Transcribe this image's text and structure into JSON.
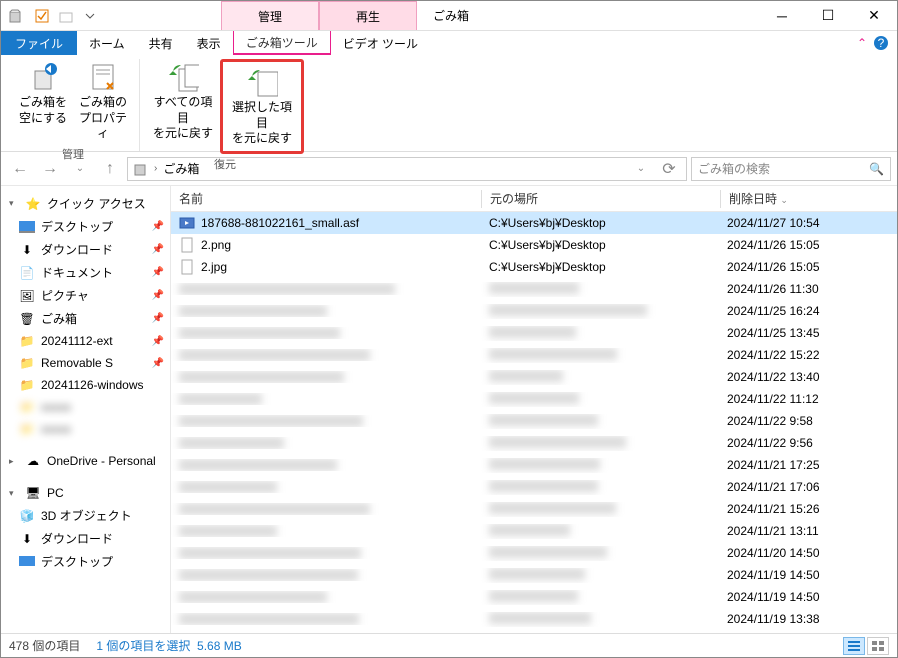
{
  "window": {
    "title": "ごみ箱"
  },
  "context_tabs": {
    "manage": "管理",
    "play": "再生"
  },
  "tabs": {
    "file": "ファイル",
    "home": "ホーム",
    "share": "共有",
    "view": "表示",
    "recycle_tools": "ごみ箱ツール",
    "video_tools": "ビデオ ツール"
  },
  "ribbon": {
    "empty": "ごみ箱を\n空にする",
    "props": "ごみ箱の\nプロパティ",
    "group_manage": "管理",
    "restore_all": "すべての項目\nを元に戻す",
    "restore_sel": "選択した項目\nを元に戻す",
    "group_restore": "復元"
  },
  "address": {
    "location": "ごみ箱"
  },
  "search": {
    "placeholder": "ごみ箱の検索"
  },
  "nav": {
    "quick": "クイック アクセス",
    "desktop": "デスクトップ",
    "downloads": "ダウンロード",
    "documents": "ドキュメント",
    "pictures": "ピクチャ",
    "recycle": "ごみ箱",
    "f1": "20241112-ext",
    "f2": "Removable S",
    "f3": "20241126-windows",
    "onedrive": "OneDrive - Personal",
    "pc": "PC",
    "objects3d": "3D オブジェクト",
    "downloads2": "ダウンロード",
    "desktop2": "デスクトップ"
  },
  "cols": {
    "name": "名前",
    "loc": "元の場所",
    "date": "削除日時"
  },
  "files": [
    {
      "name": "187688-881022161_small.asf",
      "loc": "C:¥Users¥bj¥Desktop",
      "date": "2024/11/27 10:54",
      "selected": true,
      "blur": false,
      "icon": "video"
    },
    {
      "name": "2.png",
      "loc": "C:¥Users¥bj¥Desktop",
      "date": "2024/11/26 15:05",
      "blur": false,
      "icon": "file"
    },
    {
      "name": "2.jpg",
      "loc": "C:¥Users¥bj¥Desktop",
      "date": "2024/11/26 15:05",
      "blur": false,
      "icon": "file"
    },
    {
      "name": "x",
      "loc": "x sd-u...",
      "date": "2024/11/26 11:30",
      "blur": true
    },
    {
      "name": "x",
      "loc": "x",
      "date": "2024/11/25 16:24",
      "blur": true
    },
    {
      "name": "x",
      "loc": "x",
      "date": "2024/11/25 13:45",
      "blur": true
    },
    {
      "name": "x",
      "loc": "x",
      "date": "2024/11/22 15:22",
      "blur": true
    },
    {
      "name": "x",
      "loc": "x",
      "date": "2024/11/22 13:40",
      "blur": true
    },
    {
      "name": "x",
      "loc": "x",
      "date": "2024/11/22 11:12",
      "blur": true
    },
    {
      "name": "x",
      "loc": "",
      "date": "2024/11/22 9:58",
      "blur": true
    },
    {
      "name": "x",
      "loc": "",
      "date": "2024/11/22 9:56",
      "blur": true
    },
    {
      "name": "x",
      "loc": "x",
      "date": "2024/11/21 17:25",
      "blur": true
    },
    {
      "name": "x",
      "loc": "x",
      "date": "2024/11/21 17:06",
      "blur": true
    },
    {
      "name": "x",
      "loc": "x",
      "date": "2024/11/21 15:26",
      "blur": true
    },
    {
      "name": "x",
      "loc": "",
      "date": "2024/11/21 13:11",
      "blur": true
    },
    {
      "name": "x",
      "loc": "x",
      "date": "2024/11/20 14:50",
      "blur": true
    },
    {
      "name": "x",
      "loc": "x",
      "date": "2024/11/19 14:50",
      "blur": true
    },
    {
      "name": "x",
      "loc": "x",
      "date": "2024/11/19 14:50",
      "blur": true
    },
    {
      "name": "x",
      "loc": "x",
      "date": "2024/11/19 13:38",
      "blur": true
    }
  ],
  "status": {
    "count": "478 個の項目",
    "selected": "1 個の項目を選択",
    "size": "5.68 MB"
  }
}
